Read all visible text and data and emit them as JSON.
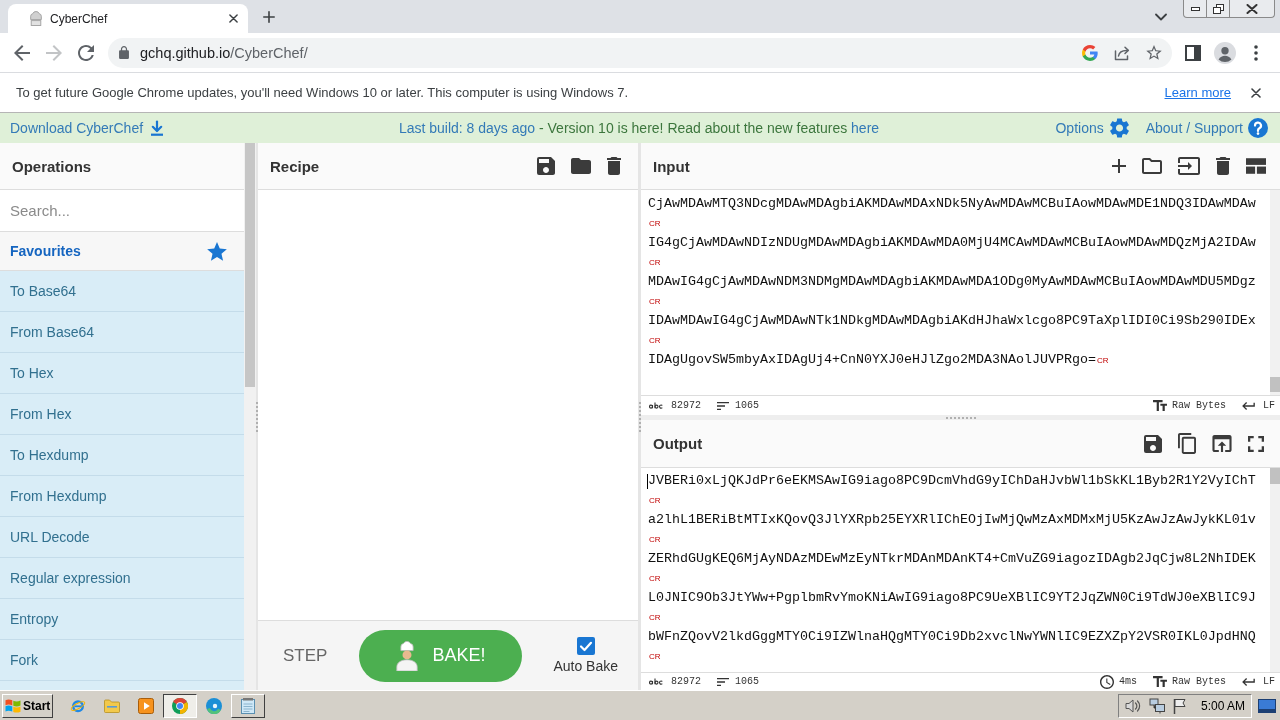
{
  "browser": {
    "tab": {
      "title": "CyberChef"
    },
    "address": {
      "host": "gchq.github.io",
      "path": "/CyberChef/"
    }
  },
  "update_bar": {
    "message": "To get future Google Chrome updates, you'll need Windows 10 or later. This computer is using Windows 7.",
    "link": "Learn more"
  },
  "banner": {
    "download": "Download CyberChef",
    "build_link": "Last build: 8 days ago",
    "notice": "- Version 10 is here! Read about the new features",
    "notice_link": "here",
    "options": "Options",
    "about": "About / Support"
  },
  "operations": {
    "title": "Operations",
    "search": {
      "placeholder": "Search..."
    },
    "category": "Favourites",
    "items": [
      "To Base64",
      "From Base64",
      "To Hex",
      "From Hex",
      "To Hexdump",
      "From Hexdump",
      "URL Decode",
      "Regular expression",
      "Entropy",
      "Fork"
    ]
  },
  "recipe": {
    "title": "Recipe",
    "step": "STEP",
    "bake": "BAKE!",
    "auto_bake": {
      "label": "Auto Bake",
      "checked": true
    }
  },
  "input": {
    "title": "Input",
    "lines": [
      {
        "text": "CjAwMDAwMTQ3NDcgMDAwMDAgbiAKMDAwMDAxNDk5NyAwMDAwMCBuIAowMDAwMDE1NDQ3IDAwMDAw",
        "eol": "CR"
      },
      {
        "text": "IG4gCjAwMDAwNDIzNDUgMDAwMDAgbiAKMDAwMDA0MjU4MCAwMDAwMCBuIAowMDAwMDQzMjA2IDAw",
        "eol": "CR"
      },
      {
        "text": "MDAwIG4gCjAwMDAwNDM3NDMgMDAwMDAgbiAKMDAwMDA1ODg0MyAwMDAwMCBuIAowMDAwMDU5MDgz",
        "eol": "CR"
      },
      {
        "text": "IDAwMDAwIG4gCjAwMDAwNTk1NDkgMDAwMDAgbiAKdHJhaWxlcgo8PC9TaXplIDI0Ci9Sb290IDEx",
        "eol": "CR"
      },
      {
        "text": "IDAgUgovSW5mbyAxIDAgUj4+CnN0YXJ0eHJlZgo2MDA3NAolJUVPRgo=",
        "eol": "CR"
      }
    ],
    "status": {
      "length": "82972",
      "line_count": "1065",
      "format": "Raw Bytes",
      "eol": "LF"
    }
  },
  "output": {
    "title": "Output",
    "lines": [
      {
        "text": "JVBERi0xLjQKJdPr6eEKMSAwIG9iago8PC9DcmVhdG9yIChDaHJvbWl1bSkKL1Byb2R1Y2VyIChT",
        "eol": "CR"
      },
      {
        "text": "a2lhL1BERiBtMTIxKQovQ3JlYXRpb25EYXRlIChEOjIwMjQwMzAxMDMxMjU5KzAwJzAwJykKL01v",
        "eol": "CR"
      },
      {
        "text": "ZERhdGUgKEQ6MjAyNDAzMDEwMzEyNTkrMDAnMDAnKT4+CmVuZG9iagozIDAgb2JqCjw8L2NhIDEK",
        "eol": "CR"
      },
      {
        "text": "L0JNIC9Ob3JtYWw+PgplbmRvYmoKNiAwIG9iago8PC9UeXBlIC9YT2JqZWN0Ci9TdWJ0eXBlIC9J",
        "eol": "CR"
      },
      {
        "text": "bWFnZQovV2lkdGggMTY0Ci9IZWlnaHQgMTY0Ci9Db2xvclNwYWNlIC9EZXZpY2VSR0IKL0JpdHNQ",
        "eol": "CR"
      }
    ],
    "status": {
      "length": "82972",
      "line_count": "1065",
      "time": "4ms",
      "format": "Raw Bytes",
      "eol": "LF"
    }
  },
  "taskbar": {
    "start": "Start",
    "buttons": [
      {
        "kind": "launcher",
        "selected": false
      },
      {
        "kind": "launcher",
        "selected": false
      },
      {
        "kind": "launcher",
        "selected": false
      },
      {
        "kind": "window",
        "selected": true
      },
      {
        "kind": "launcher",
        "selected": false
      },
      {
        "kind": "window",
        "selected": false
      }
    ],
    "clock": "5:00 AM"
  }
}
